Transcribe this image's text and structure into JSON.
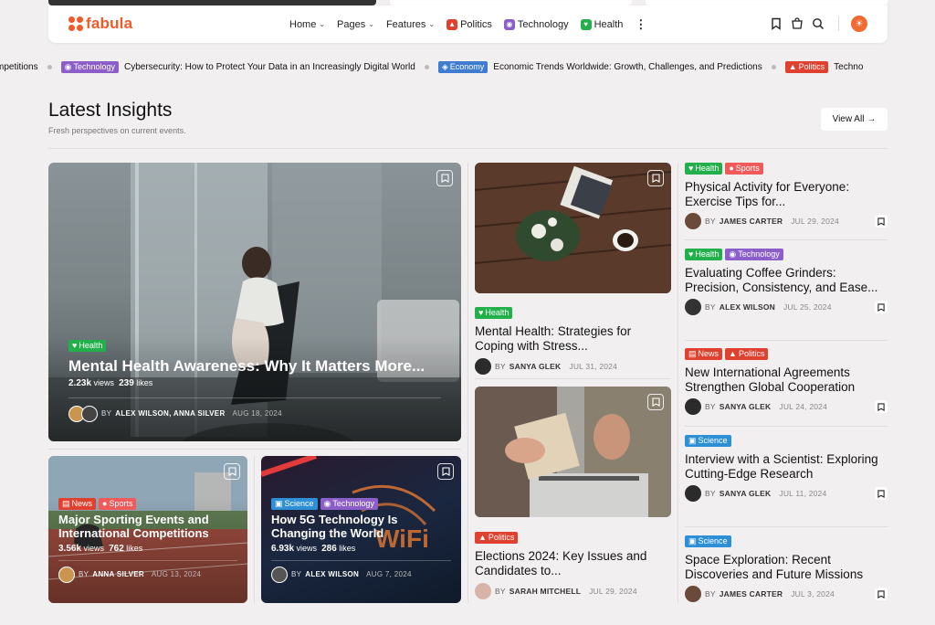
{
  "brand": {
    "name": "fabula",
    "accent": "#f05a28"
  },
  "nav": {
    "home": "Home",
    "pages": "Pages",
    "features": "Features",
    "politics": "Politics",
    "technology": "Technology",
    "health": "Health"
  },
  "ticker": [
    {
      "prefix": "mpetitions"
    },
    {
      "badge": "Technology",
      "title": "Cybersecurity: How to Protect Your Data in an Increasingly Digital World"
    },
    {
      "badge": "Economy",
      "title": "Economic Trends Worldwide: Growth, Challenges, and Predictions"
    },
    {
      "badge": "Politics",
      "title": "Techno"
    }
  ],
  "section": {
    "title": "Latest Insights",
    "subtitle": "Fresh perspectives on current events.",
    "view_all": "View All"
  },
  "hero": {
    "badge": "Health",
    "title": "Mental Health Awareness: Why It Matters More...",
    "views": "2.23k",
    "views_label": "views",
    "likes": "239",
    "likes_label": "likes",
    "by": "BY",
    "authors": "ALEX WILSON, ANNA SILVER",
    "date": "AUG 18, 2024"
  },
  "small1": {
    "badge1": "News",
    "badge2": "Sports",
    "title": "Major Sporting Events and International Competitions",
    "views": "3.56k",
    "views_label": "views",
    "likes": "762",
    "likes_label": "likes",
    "by": "BY",
    "author": "ANNA SILVER",
    "date": "AUG 13, 2024"
  },
  "small2": {
    "badge1": "Science",
    "badge2": "Technology",
    "title": "How 5G Technology Is Changing the World",
    "views": "6.93k",
    "views_label": "views",
    "likes": "286",
    "likes_label": "likes",
    "by": "BY",
    "author": "ALEX WILSON",
    "date": "AUG 7, 2024",
    "img_text": "WiFi"
  },
  "mid1": {
    "badge": "Health",
    "title": "Mental Health: Strategies for Coping with Stress...",
    "by": "BY",
    "author": "SANYA GLEK",
    "date": "JUL 31, 2024"
  },
  "mid2": {
    "badge": "Politics",
    "title": "Elections 2024: Key Issues and Candidates to...",
    "by": "BY",
    "author": "SARAH MITCHELL",
    "date": "JUL 29, 2024"
  },
  "right": [
    {
      "badges": [
        "Health",
        "Sports"
      ],
      "title": "Physical Activity for Everyone: Exercise Tips for...",
      "by": "BY",
      "author": "JAMES CARTER",
      "date": "JUL 29, 2024"
    },
    {
      "badges": [
        "Health",
        "Technology"
      ],
      "title": "Evaluating Coffee Grinders: Precision, Consistency, and Ease...",
      "by": "BY",
      "author": "ALEX WILSON",
      "date": "JUL 25, 2024"
    },
    {
      "badges": [
        "News",
        "Politics"
      ],
      "title": "New International Agreements Strengthen Global Cooperation",
      "by": "BY",
      "author": "SANYA GLEK",
      "date": "JUL 24, 2024"
    },
    {
      "badges": [
        "Science"
      ],
      "title": "Interview with a Scientist: Exploring Cutting-Edge Research",
      "by": "BY",
      "author": "SANYA GLEK",
      "date": "JUL 11, 2024"
    },
    {
      "badges": [
        "Science"
      ],
      "title": "Space Exploration: Recent Discoveries and Future Missions",
      "by": "BY",
      "author": "JAMES CARTER",
      "date": "JUL 3, 2024"
    }
  ]
}
